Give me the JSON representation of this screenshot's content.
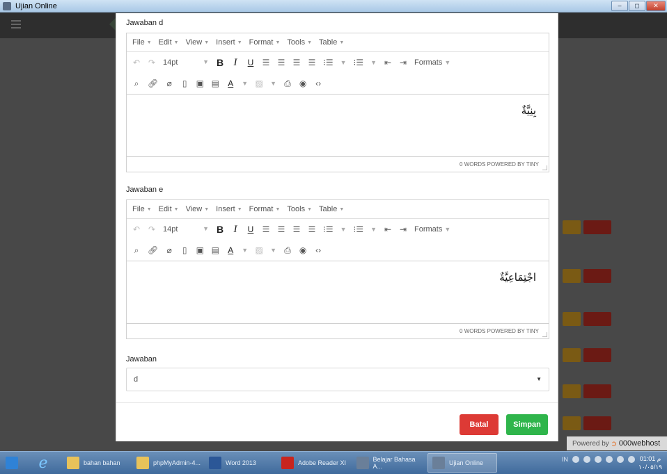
{
  "window": {
    "title": "Ujian Online",
    "buttons": [
      "–",
      "◻",
      "✕"
    ]
  },
  "editors": [
    {
      "label": "Jawaban d",
      "menu": [
        "File",
        "Edit",
        "View",
        "Insert",
        "Format",
        "Tools",
        "Table"
      ],
      "font_size": "14pt",
      "formats_label": "Formats",
      "content": "بِنِيَّةٌ",
      "status": "0 WORDS POWERED BY TINY"
    },
    {
      "label": "Jawaban e",
      "menu": [
        "File",
        "Edit",
        "View",
        "Insert",
        "Format",
        "Tools",
        "Table"
      ],
      "font_size": "14pt",
      "formats_label": "Formats",
      "content": "اجْتِمَاعِيَّةٌ",
      "status": "0 WORDS POWERED BY TINY"
    }
  ],
  "answer_select": {
    "label": "Jawaban",
    "value": "d"
  },
  "footer": {
    "cancel_label": "Batal",
    "save_label": "Simpan"
  },
  "colors": {
    "cancel": "#dd3a35",
    "save": "#2fb54b"
  },
  "powered": {
    "prefix": "Powered by",
    "brand": "000webhost"
  },
  "taskbar": {
    "tasks": [
      {
        "label": "bahan bahan",
        "icon": "folder-icon",
        "color": "#e8c25a"
      },
      {
        "label": "phpMyAdmin-4...",
        "icon": "folder-icon",
        "color": "#e8c25a"
      },
      {
        "label": "Word 2013",
        "icon": "word-icon",
        "color": "#2b5797"
      },
      {
        "label": "Adobe Reader XI",
        "icon": "pdf-icon",
        "color": "#c8251e"
      },
      {
        "label": "Belajar Bahasa A...",
        "icon": "app-icon",
        "color": "#6a7f99"
      },
      {
        "label": "Ujian Online",
        "icon": "app-icon",
        "color": "#6a7f99"
      }
    ],
    "tray_lang": "IN",
    "clock_time": "01:01 م",
    "clock_date": "١٠/٠٥/١٩"
  }
}
